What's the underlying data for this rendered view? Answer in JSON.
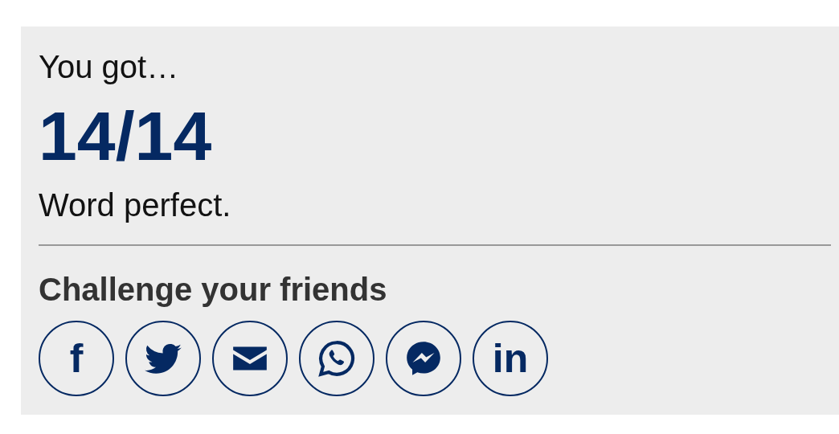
{
  "result": {
    "intro": "You got…",
    "score": "14/14",
    "message": "Word perfect."
  },
  "share": {
    "heading": "Challenge your friends",
    "buttons": [
      {
        "kind": "text",
        "label": "f"
      },
      {
        "kind": "bird"
      },
      {
        "kind": "mail"
      },
      {
        "kind": "phone-bubble"
      },
      {
        "kind": "bolt-bubble"
      },
      {
        "kind": "text",
        "label": "in"
      }
    ]
  }
}
